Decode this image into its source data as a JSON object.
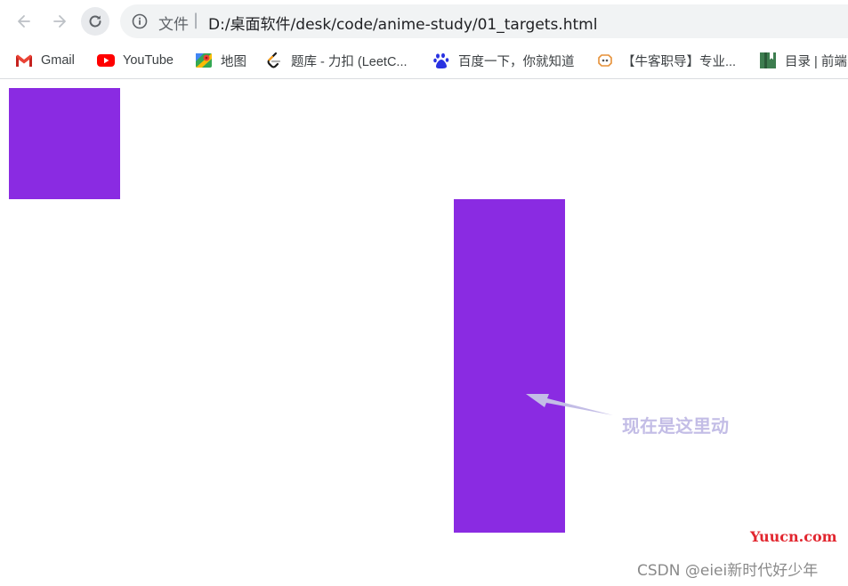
{
  "browser": {
    "nav": {
      "back_icon": "arrow-left-icon",
      "forward_icon": "arrow-right-icon",
      "reload_icon": "reload-icon"
    },
    "address_bar": {
      "info_icon": "info-icon",
      "scheme_label": "文件",
      "separator": "|",
      "url": "D:/桌面软件/desk/code/anime-study/01_targets.html"
    },
    "bookmarks": [
      {
        "label": "Gmail",
        "icon": "gmail-icon"
      },
      {
        "label": "YouTube",
        "icon": "youtube-icon"
      },
      {
        "label": "地图",
        "icon": "maps-icon"
      },
      {
        "label": "题库 - 力扣 (LeetC...",
        "icon": "leetcode-icon"
      },
      {
        "label": "百度一下，你就知道",
        "icon": "baidu-icon"
      },
      {
        "label": "【牛客职导】专业...",
        "icon": "nowcoder-icon"
      },
      {
        "label": "目录 | 前端",
        "icon": "bookmark-icon"
      }
    ]
  },
  "page": {
    "box_color": "#8a2be2",
    "annotation": "现在是这里动",
    "annotation_color": "#c3bde6"
  },
  "watermarks": {
    "site": "Yuucn.com",
    "author": "CSDN @eiei新时代好少年"
  }
}
